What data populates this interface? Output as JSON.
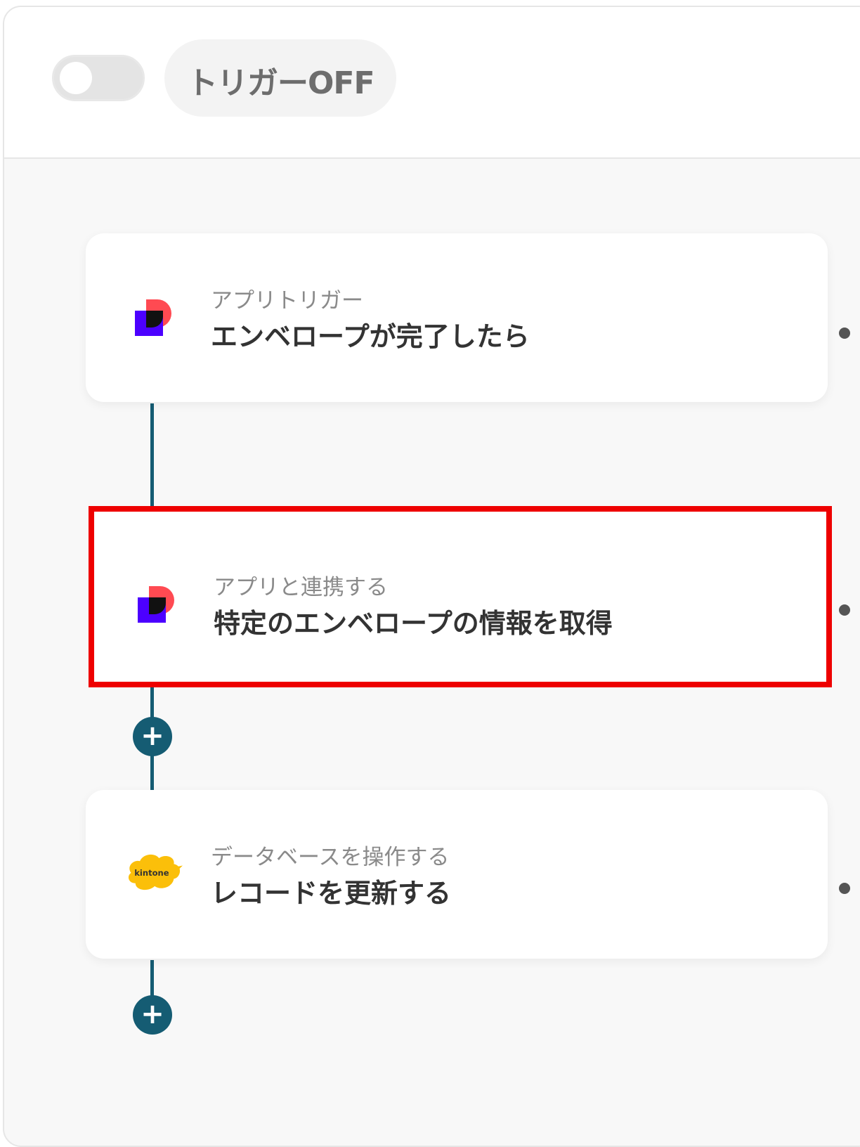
{
  "header": {
    "toggle_state": "off",
    "trigger_label": "トリガーOFF"
  },
  "steps": [
    {
      "type_label": "アプリトリガー",
      "title": "エンベロープが完了したら",
      "icon": "docusign-icon"
    },
    {
      "type_label": "アプリと連携する",
      "title": "特定のエンベロープの情報を取得",
      "icon": "docusign-icon",
      "highlighted": true
    },
    {
      "type_label": "データベースを操作する",
      "title": "レコードを更新する",
      "icon": "kintone-icon",
      "icon_text": "kintone"
    }
  ],
  "colors": {
    "connector": "#155c73",
    "highlight_border": "#ee0000",
    "kintone_yellow": "#fbbf0a"
  }
}
